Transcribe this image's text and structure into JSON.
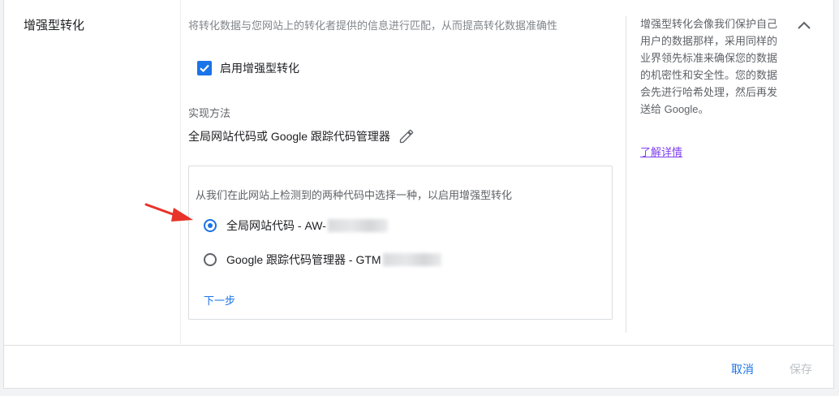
{
  "section": {
    "title": "增强型转化",
    "intro": "将转化数据与您网站上的转化者提供的信息进行匹配，从而提高转化数据准确性"
  },
  "enable": {
    "label": "启用增强型转化",
    "checked": true
  },
  "method": {
    "label": "实现方法",
    "value": "全局网站代码或 Google 跟踪代码管理器"
  },
  "choose": {
    "prompt": "从我们在此网站上检测到的两种代码中选择一种，以启用增强型转化",
    "options": [
      {
        "label": "全局网站代码 - AW-",
        "selected": true
      },
      {
        "label": "Google 跟踪代码管理器 - GTM",
        "selected": false
      }
    ],
    "next_label": "下一步"
  },
  "help": {
    "text": "增强型转化会像我们保护自己用户的数据那样，采用同样的业界领先标准来确保您的数据的机密性和安全性。您的数据会先进行哈希处理，然后再发送给 Google。",
    "link_label": "了解详情"
  },
  "footer": {
    "cancel_label": "取消",
    "save_label": "保存"
  },
  "colors": {
    "accent": "#1a73e8",
    "arrow": "#e8332a",
    "link_visited": "#7e3ff2"
  }
}
